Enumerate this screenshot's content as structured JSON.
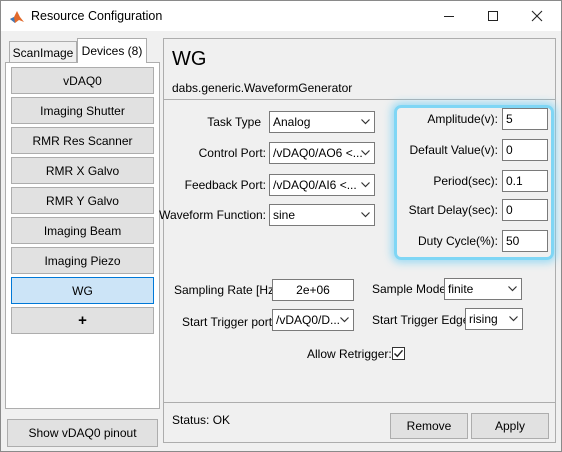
{
  "window": {
    "title": "Resource Configuration",
    "controls": {
      "minimize": "minimize-icon",
      "maximize": "maximize-icon",
      "close": "close-icon"
    }
  },
  "tabs": [
    {
      "label": "ScanImage",
      "active": false
    },
    {
      "label": "Devices (8)",
      "active": true
    }
  ],
  "devices": [
    {
      "label": "vDAQ0",
      "selected": false
    },
    {
      "label": "Imaging Shutter",
      "selected": false
    },
    {
      "label": "RMR Res Scanner",
      "selected": false
    },
    {
      "label": "RMR X Galvo",
      "selected": false
    },
    {
      "label": "RMR Y Galvo",
      "selected": false
    },
    {
      "label": "Imaging Beam",
      "selected": false
    },
    {
      "label": "Imaging Piezo",
      "selected": false
    },
    {
      "label": "WG",
      "selected": true
    },
    {
      "label": "+",
      "selected": false
    }
  ],
  "show_pinout_label": "Show vDAQ0 pinout",
  "device": {
    "name": "WG",
    "class": "dabs.generic.WaveformGenerator"
  },
  "form": {
    "task_type": {
      "label": "Task Type",
      "value": "Analog"
    },
    "control_port": {
      "label": "Control Port:",
      "value": "/vDAQ0/AO6 <..."
    },
    "feedback_port": {
      "label": "Feedback Port:",
      "value": "/vDAQ0/AI6 <..."
    },
    "waveform_function": {
      "label": "Waveform Function:",
      "value": "sine"
    },
    "amplitude": {
      "label": "Amplitude(v):",
      "value": "5"
    },
    "default_value": {
      "label": "Default Value(v):",
      "value": "0"
    },
    "period": {
      "label": "Period(sec):",
      "value": "0.1"
    },
    "start_delay": {
      "label": "Start Delay(sec):",
      "value": "0"
    },
    "duty_cycle": {
      "label": "Duty Cycle(%):",
      "value": "50"
    },
    "sampling_rate": {
      "label": "Sampling Rate [Hz]:",
      "value": "2e+06"
    },
    "sample_mode": {
      "label": "Sample Mode:",
      "value": "finite"
    },
    "start_trigger_port": {
      "label": "Start Trigger port:",
      "value": "/vDAQ0/D..."
    },
    "start_trigger_edge": {
      "label": "Start Trigger Edge:",
      "value": "rising"
    },
    "allow_retrigger": {
      "label": "Allow Retrigger:",
      "checked": true
    }
  },
  "status": "Status: OK",
  "buttons": {
    "remove": "Remove",
    "apply": "Apply"
  },
  "colors": {
    "highlight": "#7fd6f5",
    "selected_bg": "#cce4f7",
    "selected_border": "#0078d7",
    "matlab_icon": "#e26a2c"
  }
}
